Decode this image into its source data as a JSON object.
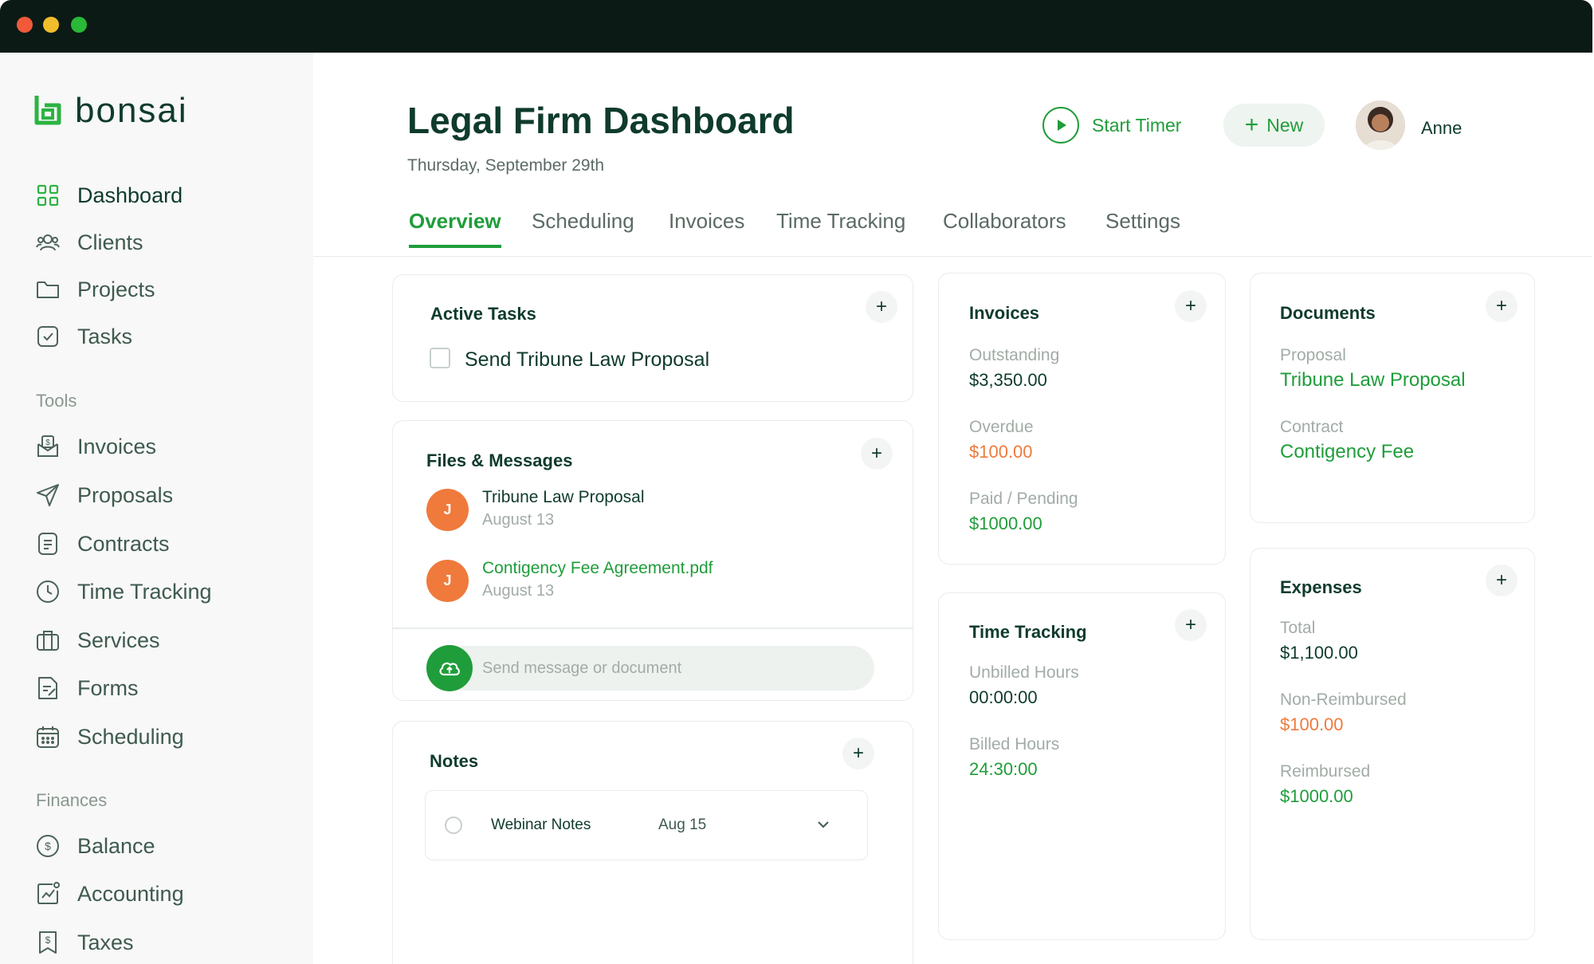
{
  "brand": {
    "name": "bonsai",
    "accent": "#1f9d3a",
    "warning": "#ef7a3b",
    "text": "#0f3b2c"
  },
  "sidebar": {
    "items": [
      {
        "label": "Dashboard",
        "icon": "grid-icon"
      },
      {
        "label": "Clients",
        "icon": "users-icon"
      },
      {
        "label": "Projects",
        "icon": "folder-icon"
      },
      {
        "label": "Tasks",
        "icon": "check-square-icon"
      }
    ],
    "tools_title": "Tools",
    "tools": [
      {
        "label": "Invoices",
        "icon": "invoice-icon"
      },
      {
        "label": "Proposals",
        "icon": "send-icon"
      },
      {
        "label": "Contracts",
        "icon": "document-icon"
      },
      {
        "label": "Time Tracking",
        "icon": "clock-icon"
      },
      {
        "label": "Services",
        "icon": "briefcase-icon"
      },
      {
        "label": "Forms",
        "icon": "form-icon"
      },
      {
        "label": "Scheduling",
        "icon": "calendar-icon"
      }
    ],
    "finances_title": "Finances",
    "finances": [
      {
        "label": "Balance",
        "icon": "dollar-circle-icon"
      },
      {
        "label": "Accounting",
        "icon": "chart-icon"
      },
      {
        "label": "Taxes",
        "icon": "tax-icon"
      }
    ]
  },
  "header": {
    "title": "Legal Firm Dashboard",
    "date": "Thursday, September 29th",
    "start_timer": "Start Timer",
    "new_label": "New",
    "user_name": "Anne"
  },
  "tabs": [
    "Overview",
    "Scheduling",
    "Invoices",
    "Time Tracking",
    "Collaborators",
    "Settings"
  ],
  "active_tasks": {
    "title": "Active Tasks",
    "add": "+",
    "tasks": [
      {
        "label": "Send Tribune Law Proposal",
        "checked": false
      }
    ]
  },
  "files": {
    "title": "Files & Messages",
    "add": "+",
    "items": [
      {
        "initial": "J",
        "name": "Tribune Law Proposal",
        "date": "August 13"
      },
      {
        "initial": "J",
        "name": "Contigency Fee Agreement.pdf",
        "date": "August 13"
      }
    ],
    "input_placeholder": "Send message or document"
  },
  "notes": {
    "title": "Notes",
    "add": "+",
    "items": [
      {
        "title": "Webinar Notes",
        "date": "Aug 15"
      }
    ]
  },
  "invoices": {
    "title": "Invoices",
    "add": "+",
    "outstanding_label": "Outstanding",
    "outstanding_value": "$3,350.00",
    "overdue_label": "Overdue",
    "overdue_value": "$100.00",
    "paid_label": "Paid / Pending",
    "paid_value": "$1000.00"
  },
  "time_tracking": {
    "title": "Time Tracking",
    "add": "+",
    "unbilled_label": "Unbilled Hours",
    "unbilled_value": "00:00:00",
    "billed_label": "Billed Hours",
    "billed_value": "24:30:00"
  },
  "documents": {
    "title": "Documents",
    "add": "+",
    "proposal_label": "Proposal",
    "proposal_value": "Tribune Law Proposal",
    "contract_label": "Contract",
    "contract_value": "Contigency Fee"
  },
  "expenses": {
    "title": "Expenses",
    "add": "+",
    "total_label": "Total",
    "total_value": "$1,100.00",
    "nonreimbursed_label": "Non-Reimbursed",
    "nonreimbursed_value": "$100.00",
    "reimbursed_label": "Reimbursed",
    "reimbursed_value": "$1000.00"
  }
}
